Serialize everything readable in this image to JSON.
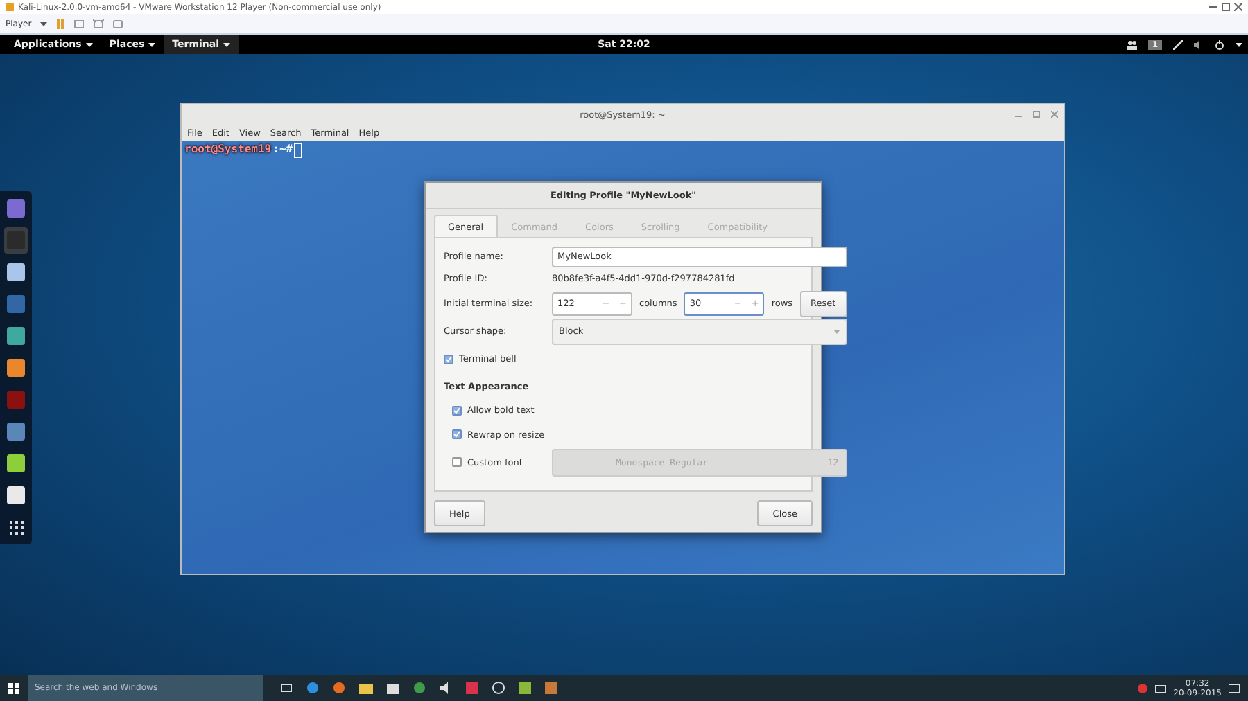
{
  "vm_window": {
    "title": "Kali-Linux-2.0.0-vm-amd64 - VMware Workstation 12 Player (Non-commercial use only)",
    "player_menu": "Player"
  },
  "top_bar": {
    "menus": [
      "Applications",
      "Places",
      "Terminal"
    ],
    "clock": "Sat 22:02",
    "workspace": "1"
  },
  "dock": [
    {
      "selected": false
    },
    {
      "selected": true
    },
    {
      "selected": false
    },
    {
      "selected": false
    },
    {
      "selected": false
    },
    {
      "selected": false
    },
    {
      "selected": false
    },
    {
      "selected": false
    },
    {
      "selected": false
    },
    {
      "selected": false
    },
    {
      "selected": false
    }
  ],
  "terminal": {
    "title": "root@System19: ~",
    "menu": [
      "File",
      "Edit",
      "View",
      "Search",
      "Terminal",
      "Help"
    ],
    "prompt_user": "root@System19",
    "prompt_path": ":~#"
  },
  "dialog": {
    "title": "Editing Profile \"MyNewLook\"",
    "tabs": [
      {
        "label": "General",
        "selected": true
      },
      {
        "label": "Command",
        "selected": false
      },
      {
        "label": "Colors",
        "selected": false
      },
      {
        "label": "Scrolling",
        "selected": false
      },
      {
        "label": "Compatibility",
        "selected": false
      }
    ],
    "profile_name": {
      "label": "Profile name:",
      "value": "MyNewLook"
    },
    "profile_id": {
      "label": "Profile ID:",
      "value": "80b8fe3f-a4f5-4dd1-970d-f297784281fd"
    },
    "size": {
      "label": "Initial terminal size:",
      "columns": "122",
      "columns_unit": "columns",
      "rows": "30",
      "rows_unit": "rows",
      "reset": "Reset",
      "minus": "−",
      "plus": "+"
    },
    "cursor_shape": {
      "label": "Cursor shape:",
      "value": "Block"
    },
    "terminal_bell": {
      "label": "Terminal bell",
      "checked": true
    },
    "section": "Text Appearance",
    "options": [
      {
        "label": "Allow bold text",
        "checked": true
      },
      {
        "label": "Rewrap on resize",
        "checked": true
      }
    ],
    "custom_font": {
      "label": "Custom font",
      "checked": false,
      "font": "Monospace Regular",
      "size": "12"
    },
    "buttons": [
      "Help",
      "Close"
    ]
  },
  "taskbar": {
    "search": {
      "placeholder": "Search the web and Windows"
    },
    "time": "07:32",
    "date": "20-09-2015"
  }
}
